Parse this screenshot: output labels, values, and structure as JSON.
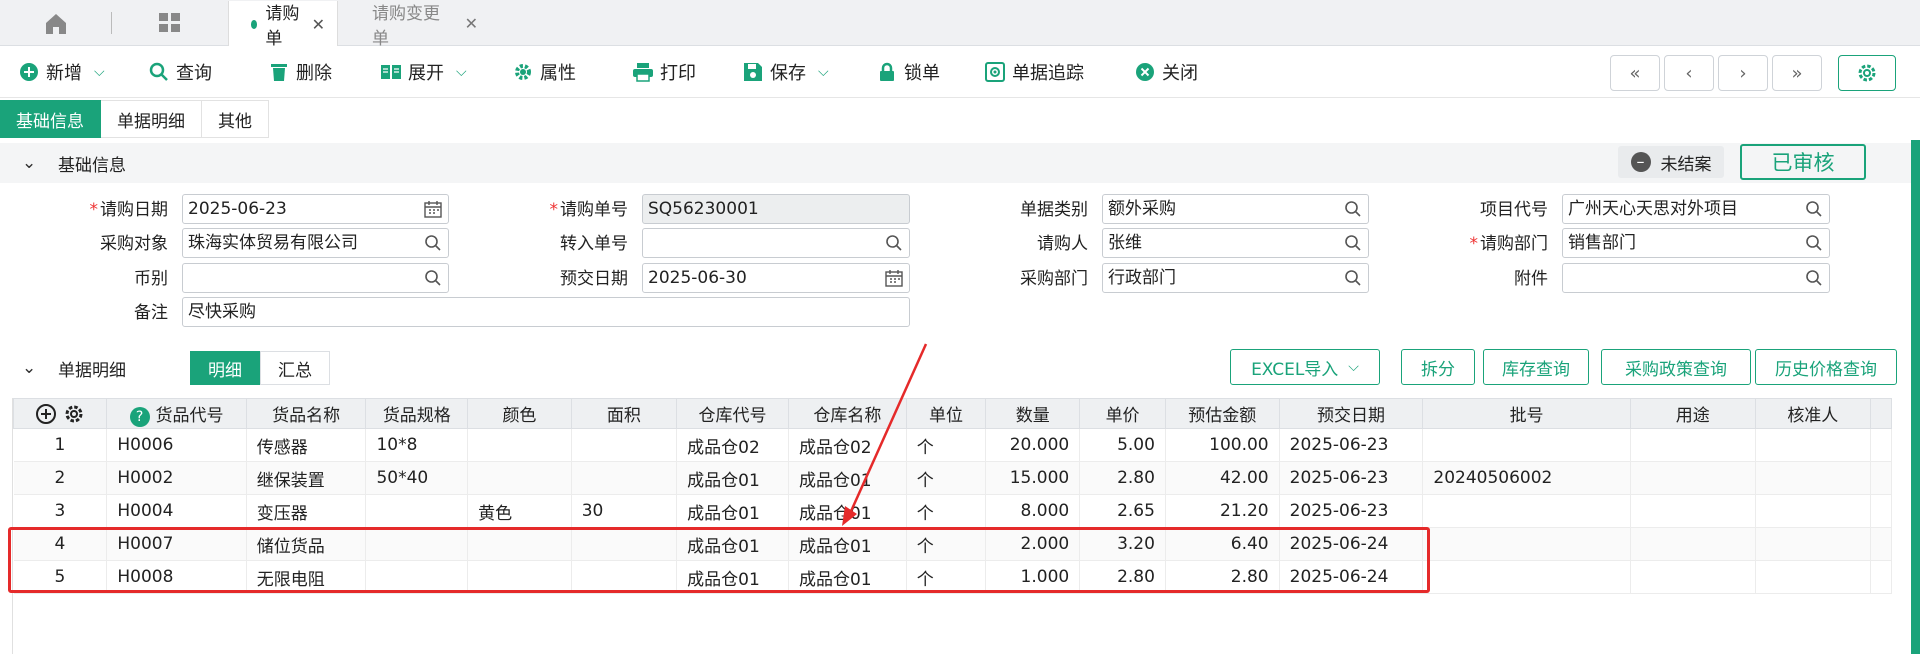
{
  "tabs": {
    "active": {
      "label": "请购单",
      "close": "✕"
    },
    "inactive": {
      "label": "请购变更单",
      "close": "✕"
    }
  },
  "toolbar": {
    "new": "新增",
    "query": "查询",
    "delete": "删除",
    "expand": "展开",
    "attr": "属性",
    "print": "打印",
    "save": "保存",
    "lock": "锁单",
    "trace": "单据追踪",
    "close": "关闭"
  },
  "nav": {
    "first": "«",
    "prev": "‹",
    "next": "›",
    "last": "»"
  },
  "section_tabs": [
    "基础信息",
    "单据明细",
    "其他"
  ],
  "basic": {
    "title": "基础信息",
    "status_unclosed": "未结案",
    "status_audited": "已审核"
  },
  "form": {
    "req_date_label": "请购日期",
    "req_date": "2025-06-23",
    "req_no_label": "请购单号",
    "req_no": "SQ56230001",
    "doc_type_label": "单据类别",
    "doc_type": "额外采购",
    "project_label": "项目代号",
    "project": "广州天心天思对外项目",
    "purchase_target_label": "采购对象",
    "purchase_target": "珠海实体贸易有限公司",
    "transfer_no_label": "转入单号",
    "transfer_no": "",
    "requester_label": "请购人",
    "requester": "张维",
    "req_dept_label": "请购部门",
    "req_dept": "销售部门",
    "currency_label": "币别",
    "currency": "",
    "delivery_date_label": "预交日期",
    "delivery_date": "2025-06-30",
    "purchase_dept_label": "采购部门",
    "purchase_dept": "行政部门",
    "attachment_label": "附件",
    "attachment": "",
    "remark_label": "备注",
    "remark": "尽快采购",
    "required_mark": "*"
  },
  "detail": {
    "title": "单据明细",
    "seg_detail": "明细",
    "seg_summary": "汇总",
    "excel_import": "EXCEL导入",
    "split": "拆分",
    "stock_query": "库存查询",
    "policy_query": "采购政策查询",
    "price_history": "历史价格查询"
  },
  "table": {
    "columns": [
      "货品代号",
      "货品名称",
      "货品规格",
      "颜色",
      "面积",
      "仓库代号",
      "仓库名称",
      "单位",
      "数量",
      "单价",
      "预估金额",
      "预交日期",
      "批号",
      "用途",
      "核准人"
    ],
    "rows": [
      [
        "1",
        "H0006",
        "传感器",
        "10*8",
        "",
        "",
        "成品仓02",
        "成品仓02",
        "个",
        "20.000",
        "5.00",
        "100.00",
        "2025-06-23",
        "",
        "",
        ""
      ],
      [
        "2",
        "H0002",
        "继保装置",
        "50*40",
        "",
        "",
        "成品仓01",
        "成品仓01",
        "个",
        "15.000",
        "2.80",
        "42.00",
        "2025-06-23",
        "20240506002",
        "",
        ""
      ],
      [
        "3",
        "H0004",
        "变压器",
        "",
        "黄色",
        "30",
        "成品仓01",
        "成品仓01",
        "个",
        "8.000",
        "2.65",
        "21.20",
        "2025-06-23",
        "",
        "",
        ""
      ],
      [
        "4",
        "H0007",
        "储位货品",
        "",
        "",
        "",
        "成品仓01",
        "成品仓01",
        "个",
        "2.000",
        "3.20",
        "6.40",
        "2025-06-24",
        "",
        "",
        ""
      ],
      [
        "5",
        "H0008",
        "无限电阻",
        "",
        "",
        "",
        "成品仓01",
        "成品仓01",
        "个",
        "1.000",
        "2.80",
        "2.80",
        "2025-06-24",
        "",
        "",
        ""
      ]
    ]
  },
  "colors": {
    "accent": "#1aa37a",
    "highlight": "#e52a2a",
    "required": "#ee3333"
  }
}
